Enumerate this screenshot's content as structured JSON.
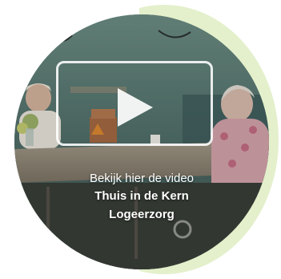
{
  "video": {
    "intro": "Bekijk hier de video",
    "title_line1": "Thuis in de Kern",
    "title_line2": "Logeerzorg"
  },
  "colors": {
    "accent": "#e4f0cc",
    "caption_text": "#ffffff"
  },
  "icons": {
    "play": "play-icon"
  }
}
